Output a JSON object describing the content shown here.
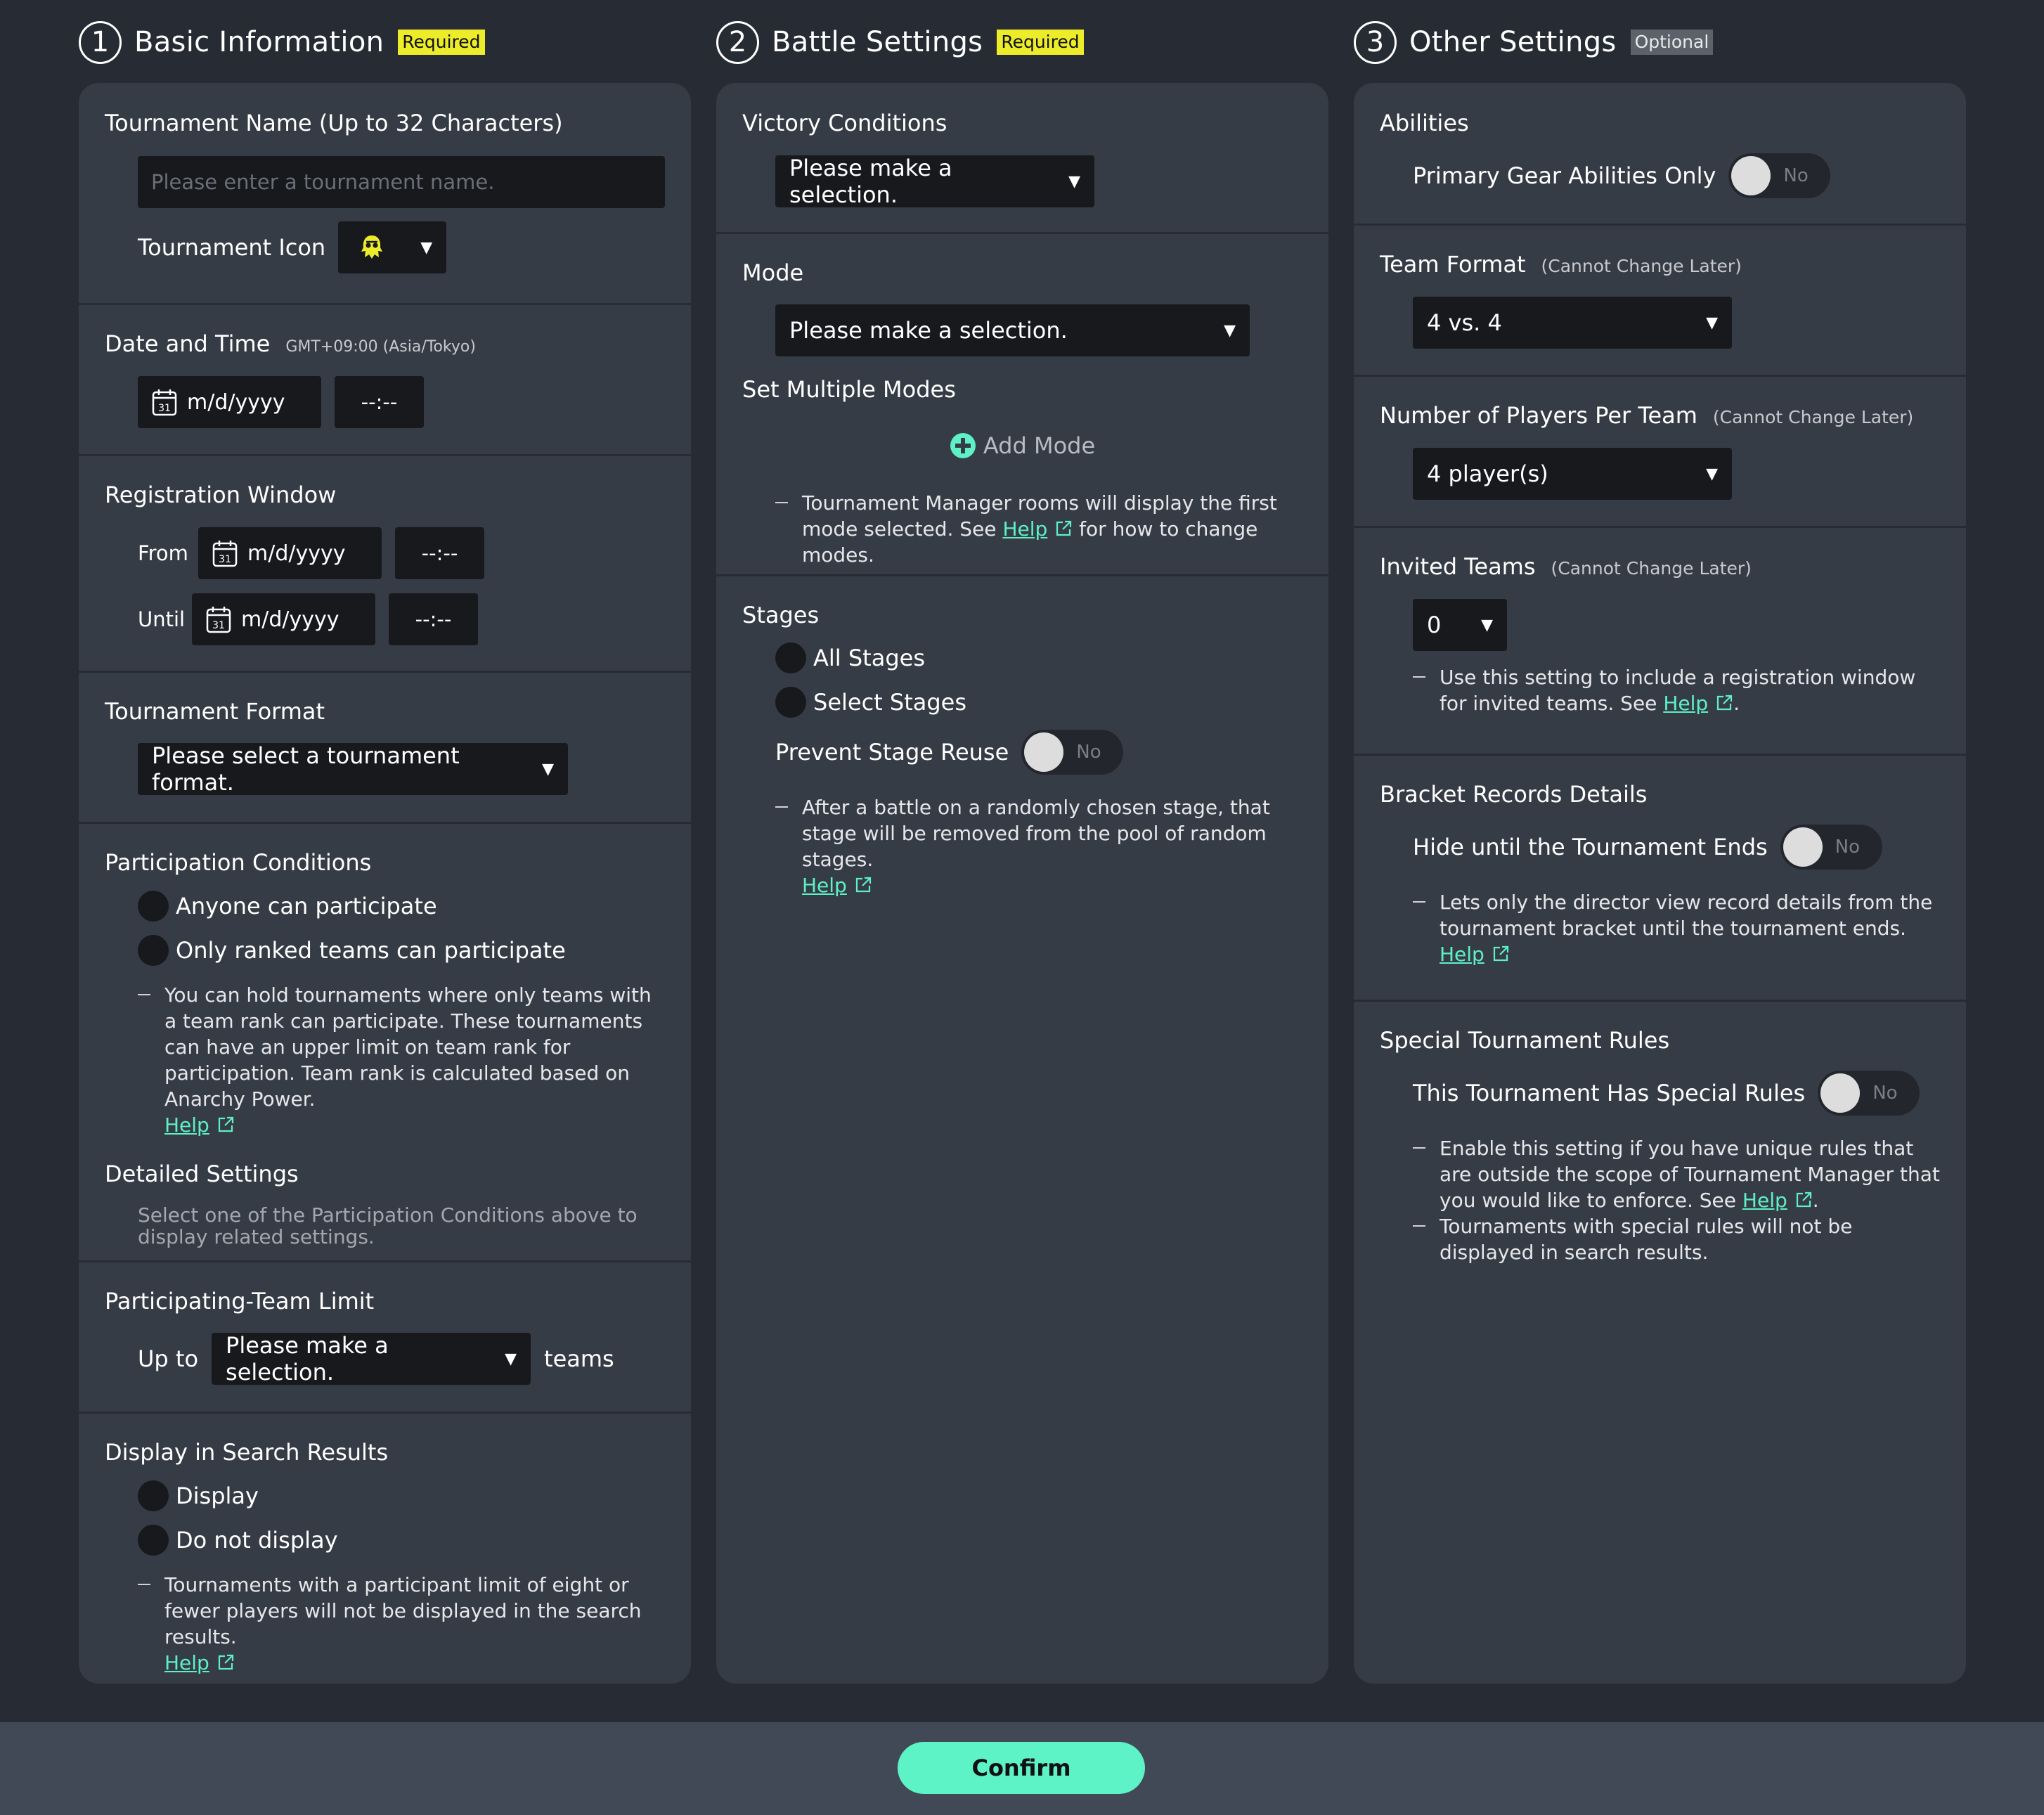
{
  "col1": {
    "step": "1",
    "title": "Basic Information",
    "tag": "Required",
    "tournament_name": {
      "label": "Tournament Name (Up to 32 Characters)",
      "placeholder": "Please enter a tournament name.",
      "icon_label": "Tournament Icon"
    },
    "date_time": {
      "label": "Date and Time",
      "tz": "GMT+09:00 (Asia/Tokyo)",
      "date": "m/d/yyyy",
      "time": "--:--"
    },
    "registration": {
      "label": "Registration Window",
      "from": "From",
      "until": "Until",
      "from_date": "m/d/yyyy",
      "from_time": "--:--",
      "until_date": "m/d/yyyy",
      "until_time": "--:--"
    },
    "format": {
      "label": "Tournament Format",
      "value": "Please select a tournament format."
    },
    "participation": {
      "label": "Participation Conditions",
      "options": [
        "Anyone can participate",
        "Only ranked teams can participate"
      ],
      "note": "You can hold tournaments where only teams with a team rank can participate. These tournaments can have an upper limit on team rank for participation. Team rank is calculated based on Anarchy Power.",
      "help": "Help",
      "detailed_label": "Detailed Settings",
      "detailed_note": "Select one of the Participation Conditions above to display related settings."
    },
    "team_limit": {
      "label": "Participating-Team Limit",
      "prefix": "Up to",
      "value": "Please make a selection.",
      "suffix": "teams"
    },
    "search": {
      "label": "Display in Search Results",
      "options": [
        "Display",
        "Do not display"
      ],
      "note": "Tournaments with a participant limit of eight or fewer players will not be displayed in the search results.",
      "help": "Help"
    }
  },
  "col2": {
    "step": "2",
    "title": "Battle Settings",
    "tag": "Required",
    "victory": {
      "label": "Victory Conditions",
      "value": "Please make a selection."
    },
    "mode": {
      "label": "Mode",
      "value": "Please make a selection.",
      "multi_label": "Set Multiple Modes",
      "add_mode": "Add Mode",
      "note_a": "Tournament Manager rooms will display the first mode selected. See ",
      "help": "Help",
      "note_b": " for how to change modes."
    },
    "stages": {
      "label": "Stages",
      "options": [
        "All Stages",
        "Select Stages"
      ],
      "prevent_label": "Prevent Stage Reuse",
      "toggle": "No",
      "note": "After a battle on a randomly chosen stage, that stage will be removed from the pool of random stages.",
      "help": "Help"
    }
  },
  "col3": {
    "step": "3",
    "title": "Other Settings",
    "tag": "Optional",
    "abilities": {
      "label": "Abilities",
      "option": "Primary Gear Abilities Only",
      "toggle": "No"
    },
    "team_format": {
      "label": "Team Format",
      "note": "(Cannot Change Later)",
      "value": "4 vs. 4"
    },
    "players": {
      "label": "Number of Players Per Team",
      "note": "(Cannot Change Later)",
      "value": "4 player(s)"
    },
    "invited": {
      "label": "Invited Teams",
      "note": "(Cannot Change Later)",
      "value": "0",
      "desc_a": "Use this setting to include a registration window for invited teams. See ",
      "help": "Help",
      "desc_b": "."
    },
    "bracket": {
      "label": "Bracket Records Details",
      "option": "Hide until the Tournament Ends",
      "toggle": "No",
      "note": "Lets only the director view record details from the tournament bracket until the tournament ends.",
      "help": "Help"
    },
    "special": {
      "label": "Special Tournament Rules",
      "option": "This Tournament Has Special Rules",
      "toggle": "No",
      "note1_a": "Enable this setting if you have unique rules that are outside the scope of Tournament Manager that you would like to enforce. See ",
      "help": "Help",
      "note1_b": ".",
      "note2": "Tournaments with special rules will not be displayed in search results."
    }
  },
  "footer": {
    "confirm": "Confirm"
  },
  "colors": {
    "accent": "#5ef3c7",
    "required_tag": "#ecec2b",
    "panel": "#363c46",
    "background": "#272b33"
  }
}
